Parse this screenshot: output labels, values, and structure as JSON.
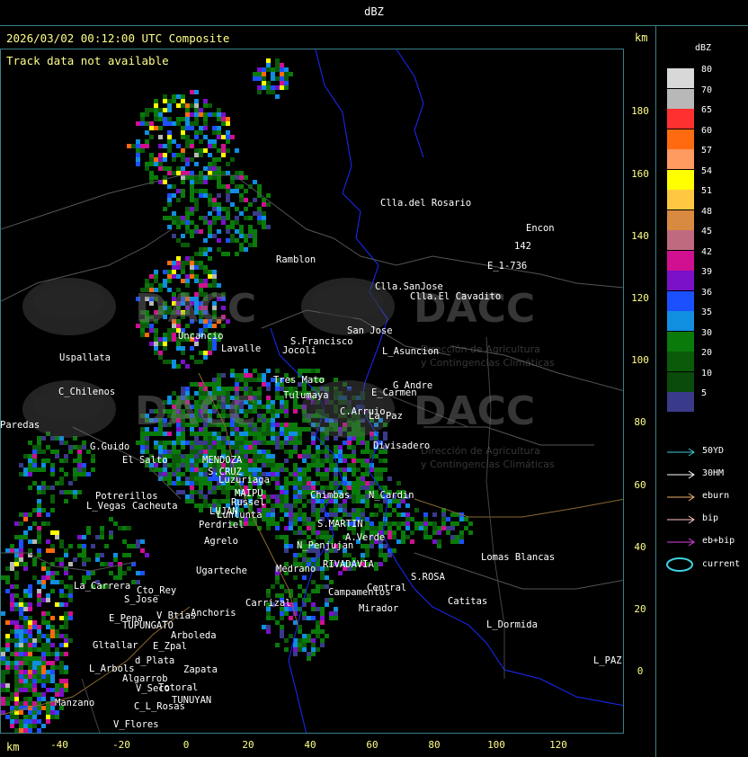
{
  "top_title": "dBZ",
  "header": "2026/03/02 00:12:00 UTC Composite",
  "track_note": "Track data not available",
  "km_label": "km",
  "y_ticks": [
    "180",
    "160",
    "140",
    "120",
    "100",
    "80",
    "60",
    "40",
    "20",
    "0"
  ],
  "x_ticks": [
    "-40",
    "-20",
    "0",
    "20",
    "40",
    "60",
    "80",
    "100",
    "120"
  ],
  "legend": {
    "title": "dBZ",
    "colors": [
      {
        "label": "80",
        "color": "#d8d8d8"
      },
      {
        "label": "70",
        "color": "#b8b8b8"
      },
      {
        "label": "65",
        "color": "#ff3030"
      },
      {
        "label": "60",
        "color": "#ff6a10"
      },
      {
        "label": "57",
        "color": "#ff9a60"
      },
      {
        "label": "54",
        "color": "#ffff00"
      },
      {
        "label": "51",
        "color": "#ffc840"
      },
      {
        "label": "48",
        "color": "#d88a40"
      },
      {
        "label": "45",
        "color": "#c06a80"
      },
      {
        "label": "42",
        "color": "#d01090"
      },
      {
        "label": "39",
        "color": "#7a10c8"
      },
      {
        "label": "36",
        "color": "#1c50ff"
      },
      {
        "label": "35",
        "color": "#108ee0"
      },
      {
        "label": "30",
        "color": "#0a7a0a"
      },
      {
        "label": "20",
        "color": "#0a5a0a"
      },
      {
        "label": "10",
        "color": "#0a4a0a"
      },
      {
        "label": "5",
        "color": "#3a3a8a"
      }
    ],
    "tracks": [
      {
        "label": "50YD",
        "color": "#40c8d8"
      },
      {
        "label": "30HM",
        "color": "#ffffff"
      },
      {
        "label": "eburn",
        "color": "#f0b070"
      },
      {
        "label": "bip",
        "color": "#ffc8c8"
      },
      {
        "label": "eb+bip",
        "color": "#e040e0"
      }
    ],
    "current_label": "current",
    "current_color": "#40d0e0"
  },
  "cities": [
    {
      "name": "Clla.del Rosario"
    },
    {
      "name": "Encon"
    },
    {
      "name": "142"
    },
    {
      "name": "E_1-736"
    },
    {
      "name": "Ramblon"
    },
    {
      "name": "Clla.SanJose"
    },
    {
      "name": "Clla.El Cavadito"
    },
    {
      "name": "San Jose"
    },
    {
      "name": "Uspallata"
    },
    {
      "name": "S.Francisco"
    },
    {
      "name": "Jocoli"
    },
    {
      "name": "L_Asuncion"
    },
    {
      "name": "Uncancio"
    },
    {
      "name": "Lavalle"
    },
    {
      "name": "C_Chilenos"
    },
    {
      "name": "Tres Mato"
    },
    {
      "name": "E_Carmen"
    },
    {
      "name": "G_Andre"
    },
    {
      "name": "Tulumaya"
    },
    {
      "name": "Paredas"
    },
    {
      "name": "C.Arruio"
    },
    {
      "name": "La Paz"
    },
    {
      "name": "G.Guido"
    },
    {
      "name": "El Salto"
    },
    {
      "name": "MENDOZA"
    },
    {
      "name": "S.CRUZ"
    },
    {
      "name": "Luzuriaga"
    },
    {
      "name": "Divisadero"
    },
    {
      "name": "Potrerillos"
    },
    {
      "name": "L_Vegas"
    },
    {
      "name": "Cacheuta"
    },
    {
      "name": "MAIPU"
    },
    {
      "name": "Russel"
    },
    {
      "name": "LUJAN"
    },
    {
      "name": "Lunlunta"
    },
    {
      "name": "Perdriel"
    },
    {
      "name": "Agrelo"
    },
    {
      "name": "S.MARTIN"
    },
    {
      "name": "A.Verde"
    },
    {
      "name": "Ugarteche"
    },
    {
      "name": "N_Penjujan"
    },
    {
      "name": "Medrano"
    },
    {
      "name": "RIVADAVIA"
    },
    {
      "name": "Lomas Blancas"
    },
    {
      "name": "La_Carrera"
    },
    {
      "name": "Cto_Rey"
    },
    {
      "name": "S_Jose"
    },
    {
      "name": "S.ROSA"
    },
    {
      "name": "Catitas"
    },
    {
      "name": "Carrizal"
    },
    {
      "name": "Campamentos"
    },
    {
      "name": "Central"
    },
    {
      "name": "Mirador"
    },
    {
      "name": "E_Pena"
    },
    {
      "name": "TUPUNGATO"
    },
    {
      "name": "V_Btias"
    },
    {
      "name": "Anchoris"
    },
    {
      "name": "L_Dormida"
    },
    {
      "name": "Arboleda"
    },
    {
      "name": "Gltallar"
    },
    {
      "name": "E_Zpal"
    },
    {
      "name": "d_Plata"
    },
    {
      "name": "L_Arbols"
    },
    {
      "name": "Zapata"
    },
    {
      "name": "L_PAZ"
    },
    {
      "name": "Algarrob"
    },
    {
      "name": "V_Seco"
    },
    {
      "name": "Totoral"
    },
    {
      "name": "TUNUYAN"
    },
    {
      "name": "Manzano"
    },
    {
      "name": "C_L_Rosas"
    },
    {
      "name": "V_Flores"
    },
    {
      "name": "Chimbas"
    },
    {
      "name": "N_Cardin"
    }
  ],
  "watermarks": [
    {
      "text": "DACC",
      "sub": "Dirección de Agricultura\ny Contingencias Climáticas"
    },
    {
      "text": "DACC",
      "sub": "Dirección de Agricultura\ny Contingencias Climáticas"
    },
    {
      "text": "DACC",
      "sub": "Dirección de Agricultura\ny Contingencias Climáticas"
    },
    {
      "text": "DACC",
      "sub": "Dirección de Agricultura\ny Contingencias Climáticas"
    }
  ]
}
